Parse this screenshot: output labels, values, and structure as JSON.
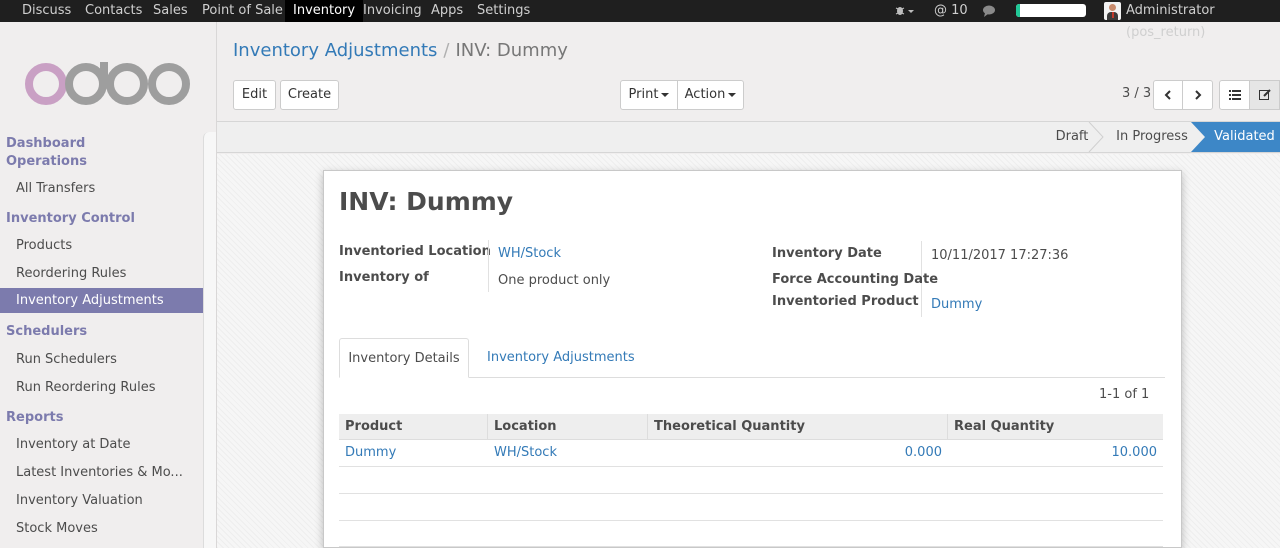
{
  "topnav": {
    "menus": [
      "Discuss",
      "Contacts",
      "Sales",
      "Point of Sale",
      "Inventory",
      "Invoicing",
      "Apps",
      "Settings"
    ],
    "active_menu": "Inventory",
    "mentions_count": "10",
    "progress_percent": 5,
    "user": "Administrator (pos_return)"
  },
  "sidebar": {
    "logo": "odoo",
    "groups": [
      {
        "title": "Dashboard Operations",
        "items": [
          "All Transfers"
        ]
      },
      {
        "title": "Inventory Control",
        "items": [
          "Products",
          "Reordering Rules",
          "Inventory Adjustments"
        ]
      },
      {
        "title": "Schedulers",
        "items": [
          "Run Schedulers",
          "Run Reordering Rules"
        ]
      },
      {
        "title": "Reports",
        "items": [
          "Inventory at Date",
          "Latest Inventories & Mo...",
          "Inventory Valuation",
          "Stock Moves"
        ]
      }
    ],
    "active_item": "Inventory Adjustments"
  },
  "breadcrumb": {
    "parent": "Inventory Adjustments",
    "current": "INV: Dummy"
  },
  "buttons": {
    "edit": "Edit",
    "create": "Create",
    "print": "Print",
    "action": "Action"
  },
  "pager": {
    "value": "3 / 3"
  },
  "status": {
    "stages": [
      "Draft",
      "In Progress",
      "Validated"
    ],
    "current": "Validated"
  },
  "form": {
    "title": "INV: Dummy",
    "labels": {
      "inventoried_location": "Inventoried Location",
      "inventory_of": "Inventory of",
      "inventory_date": "Inventory Date",
      "force_accounting_date": "Force Accounting Date",
      "inventoried_product": "Inventoried Product"
    },
    "values": {
      "inventoried_location": "WH/Stock",
      "inventory_of": "One product only",
      "inventory_date": "10/11/2017 17:27:36",
      "force_accounting_date": "",
      "inventoried_product": "Dummy"
    }
  },
  "tabs": {
    "details": "Inventory Details",
    "adjustments": "Inventory Adjustments"
  },
  "table": {
    "counter": "1-1 of 1",
    "columns": [
      "Product",
      "Location",
      "Theoretical Quantity",
      "Real Quantity"
    ],
    "rows": [
      {
        "product": "Dummy",
        "location": "WH/Stock",
        "theoretical": "0.000",
        "real": "10.000"
      }
    ]
  },
  "colors": {
    "brand": "#7c7bad",
    "link": "#337ab7",
    "status_active": "#3d87c7",
    "topbar": "#1f1f1f"
  }
}
